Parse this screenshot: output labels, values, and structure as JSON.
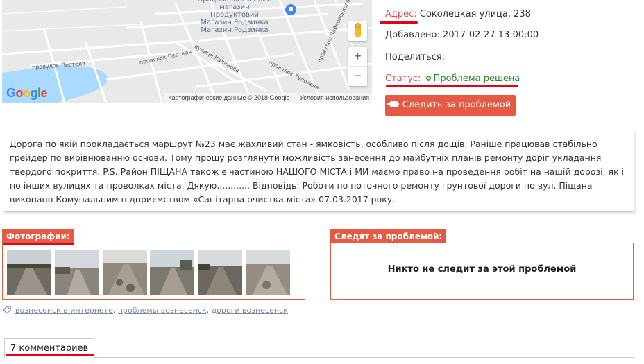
{
  "map": {
    "poi_label": "Продовольственний магазин\nПродуктовий\nМагазин Родзинка",
    "streets": [
      "провулок Пестеля",
      "вулиця Калинова",
      "провулок Пестеля",
      "провулок Туполєва",
      "провулок Чайковського"
    ],
    "google_logo": "Google",
    "attribution": "Картографические данные © 2018 Google",
    "terms": "Условия использования",
    "zoom_in": "+",
    "zoom_out": "−"
  },
  "info": {
    "address_label": "Адрес:",
    "address_value": "Соколецкая улица, 238",
    "added_label": "Добавлено:",
    "added_value": "2017-02-27 13:00:00",
    "share_label": "Поделиться:",
    "status_label": "Статус:",
    "status_value": "Проблема решена",
    "follow_button": "Следить за проблемой"
  },
  "description": "Дорога по якій прокладається маршрут №23 має жахливий стан - ямковість, особливо після дощів. Раніше працював стабільно грейдер по вирівнюванню основи. Тому прошу розглянути можливість занесення до майбутніх планів ремонту доріг укладання твердого покриття. P.S. Район ПІЩАНА також є частиною НАШОГО МІСТА і МИ маємо право на проведення робіт на нашій дорозі, як і по інших вулицях та проволках міста. Дякую............ Відповідь: Роботи по поточного ремонту ґрунтової дороги по вул. Піщана виконано Комунальним підприємством «Санітарна очистка міста» 07.03.2017 року.",
  "photos": {
    "label": "Фотографии:",
    "count": 6
  },
  "followers": {
    "label": "Следят за проблемой:",
    "empty_text": "Никто не следит за этой проблемой"
  },
  "tags": [
    "вознесенск в интернете",
    "проблемы вознесенск",
    "дороги вознесенск"
  ],
  "comments": {
    "tab_label": "7 комментариев"
  },
  "colors": {
    "accent": "#e55a45",
    "status_green": "#2a8a2a",
    "highlight_underline": "#e0001a"
  }
}
